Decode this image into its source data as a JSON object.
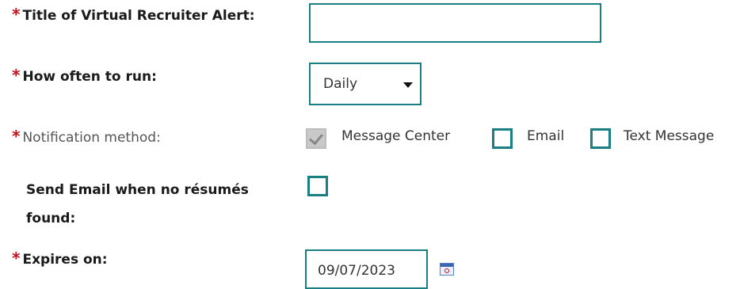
{
  "form": {
    "title": {
      "required_mark": "*",
      "label": "Title of Virtual Recruiter Alert:",
      "value": ""
    },
    "frequency": {
      "required_mark": "*",
      "label": "How often to run:",
      "selected": "Daily"
    },
    "notification": {
      "required_mark": "*",
      "label": "Notification method:",
      "options": [
        {
          "label": "Message Center",
          "checked": true,
          "disabled": true
        },
        {
          "label": "Email",
          "checked": false
        },
        {
          "label": "Text Message",
          "checked": false
        }
      ]
    },
    "no_resumes": {
      "label_line1": "Send Email when no résumés",
      "label_line2": "found:",
      "checked": false
    },
    "expires": {
      "required_mark": "*",
      "label": "Expires on:",
      "value": "09/07/2023"
    }
  },
  "colors": {
    "accent": "#1a7f83",
    "required": "#c0101a"
  }
}
